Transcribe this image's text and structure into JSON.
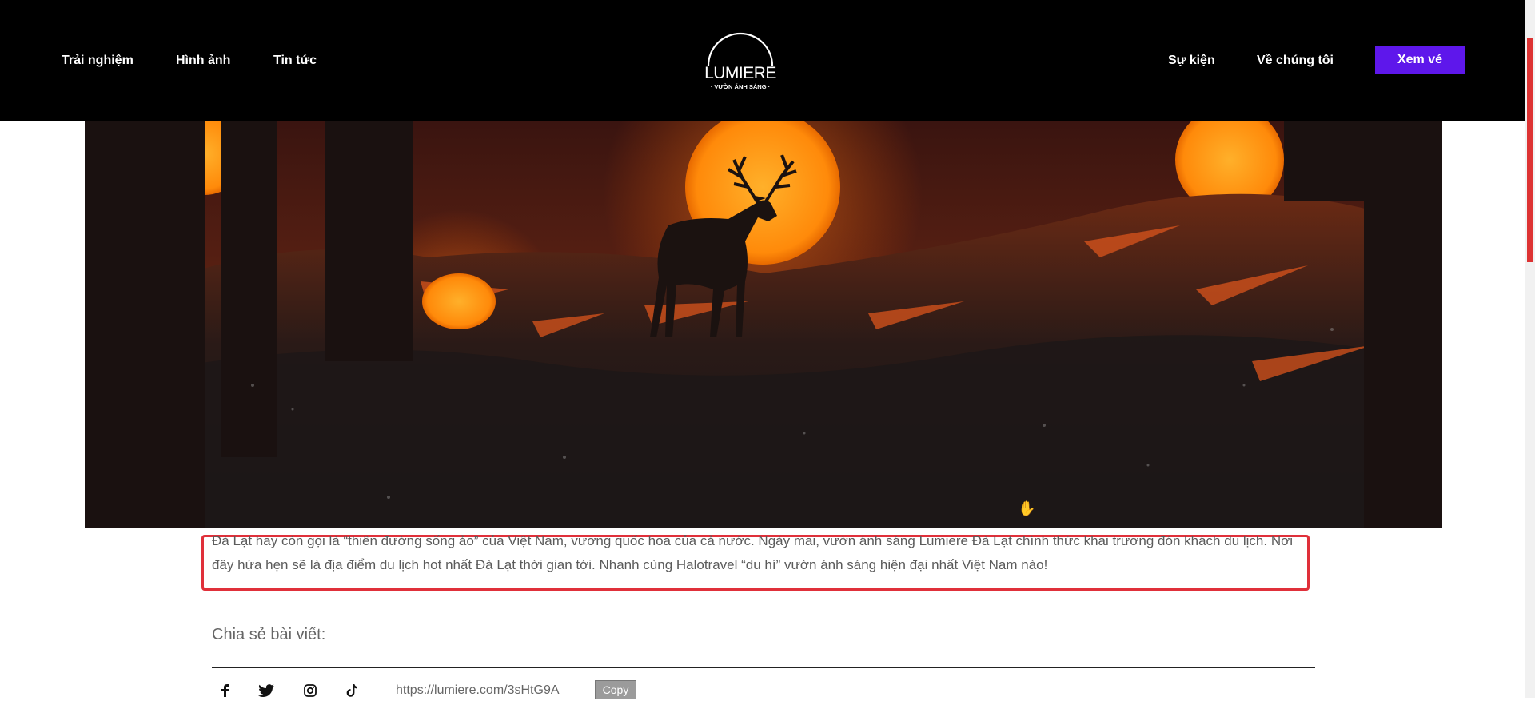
{
  "header": {
    "nav_left": [
      "Trải nghiệm",
      "Hình ảnh",
      "Tin tức"
    ],
    "nav_right": [
      "Sự kiện",
      "Về chúng tôi"
    ],
    "logo_name": "LUMIERE",
    "logo_tagline": "· VƯỜN ÁNH SÁNG ·",
    "ticket_button": "Xem vé",
    "accent_color": "#5e17eb"
  },
  "article": {
    "intro": "Đà Lạt hay còn gọi là “thiên đường sống ảo” của Việt Nam, vương quốc hoa của cả nước. Ngày mai, vườn ánh sáng Lumiere Đà Lạt chính thức khai trương đón khách du lịch.  Nơi đây hứa hẹn sẽ là địa điểm du lịch hot nhất Đà Lạt thời gian tới. Nhanh cùng Halotravel “du hí” vườn ánh sáng hiện đại nhất Việt Nam nào!",
    "highlight_color": "#e0303a"
  },
  "share": {
    "label": "Chia sẻ bài viết:",
    "icons": [
      "facebook-icon",
      "twitter-icon",
      "instagram-icon",
      "tiktok-icon"
    ],
    "url": "https://lumiere.com/3sHtG9A",
    "copy_label": "Copy"
  }
}
